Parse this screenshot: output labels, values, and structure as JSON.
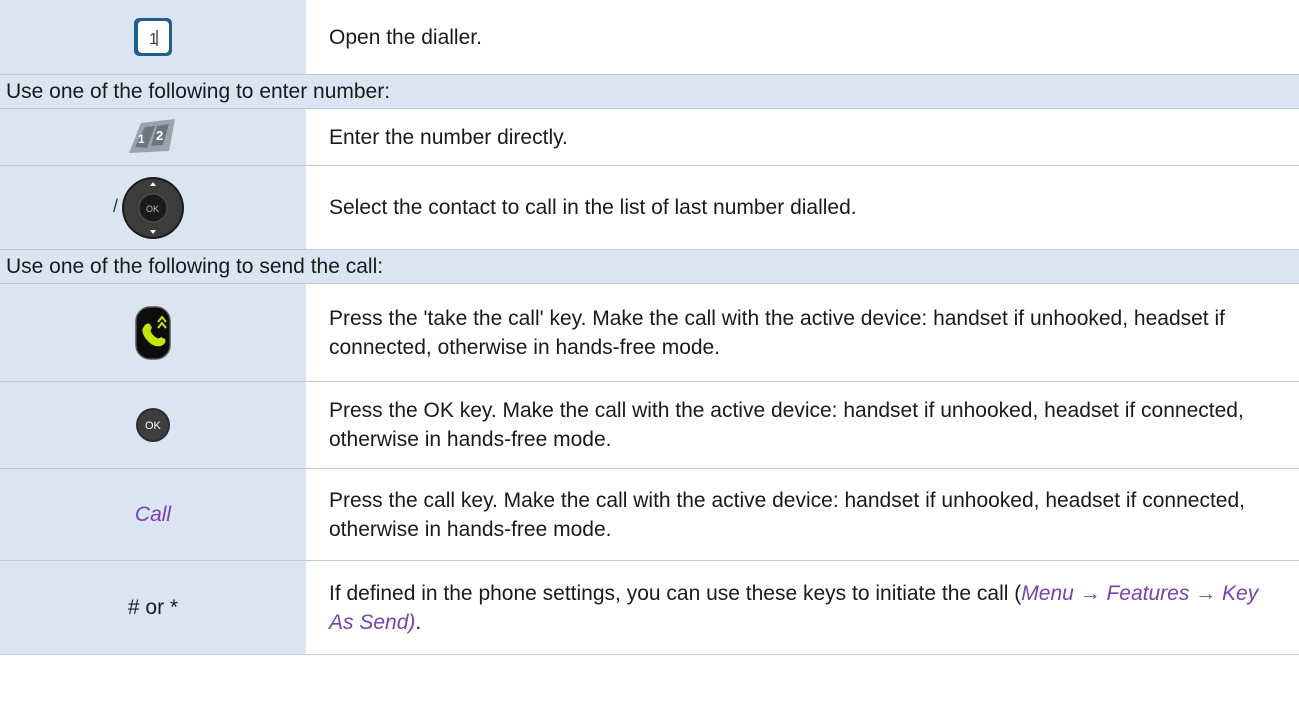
{
  "rows": [
    {
      "kind": "step",
      "icon": "dialler-icon",
      "text": "Open the dialler."
    },
    {
      "kind": "section",
      "text": "Use one of the following to enter number:"
    },
    {
      "kind": "step",
      "icon": "keypad-icon",
      "text": "Enter the number directly."
    },
    {
      "kind": "step",
      "icon": "navigator-icon",
      "left_prefix": "/",
      "text": "Select the contact to call in the list of last number dialled."
    },
    {
      "kind": "section",
      "text": "Use one of the following to send the call:"
    },
    {
      "kind": "step",
      "icon": "take-call-key-icon",
      "text": "Press the 'take the call' key. Make the call with the active device: handset if unhooked, headset if connected, otherwise in hands-free mode."
    },
    {
      "kind": "step",
      "icon": "ok-key-icon",
      "icon_label": "OK",
      "text": "Press the OK key. Make the call with the active device: handset if unhooked, headset if connected, otherwise in hands-free mode."
    },
    {
      "kind": "step",
      "left_text": "Call",
      "text": "Press the call key. Make the call with the active device: handset if unhooked, headset if connected, otherwise in hands-free mode."
    },
    {
      "kind": "step",
      "left_text": "# or *",
      "text_main": "If defined in the phone settings, you can use these keys to initiate the call (",
      "text_path": "Menu → Features → Key As Send)",
      "text_end": "."
    }
  ],
  "colors": {
    "cell_bg": "#dbe5f1",
    "border": "#b9cbe0",
    "accent_purple": "#7a3fb0"
  }
}
